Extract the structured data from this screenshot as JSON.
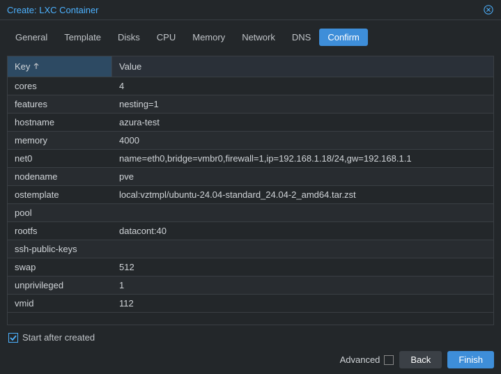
{
  "title": "Create: LXC Container",
  "tabs": [
    "General",
    "Template",
    "Disks",
    "CPU",
    "Memory",
    "Network",
    "DNS",
    "Confirm"
  ],
  "active_tab": 7,
  "columns": {
    "key": "Key",
    "value": "Value"
  },
  "rows": [
    {
      "key": "cores",
      "value": "4"
    },
    {
      "key": "features",
      "value": "nesting=1"
    },
    {
      "key": "hostname",
      "value": "azura-test"
    },
    {
      "key": "memory",
      "value": "4000"
    },
    {
      "key": "net0",
      "value": "name=eth0,bridge=vmbr0,firewall=1,ip=192.168.1.18/24,gw=192.168.1.1"
    },
    {
      "key": "nodename",
      "value": "pve"
    },
    {
      "key": "ostemplate",
      "value": "local:vztmpl/ubuntu-24.04-standard_24.04-2_amd64.tar.zst"
    },
    {
      "key": "pool",
      "value": ""
    },
    {
      "key": "rootfs",
      "value": "datacont:40"
    },
    {
      "key": "ssh-public-keys",
      "value": ""
    },
    {
      "key": "swap",
      "value": "512"
    },
    {
      "key": "unprivileged",
      "value": "1"
    },
    {
      "key": "vmid",
      "value": "112"
    }
  ],
  "start_after_created": {
    "label": "Start after created",
    "checked": true
  },
  "advanced": {
    "label": "Advanced",
    "checked": false
  },
  "buttons": {
    "back": "Back",
    "finish": "Finish"
  },
  "colors": {
    "accent": "#3e8ed9",
    "link": "#4db2ff"
  }
}
